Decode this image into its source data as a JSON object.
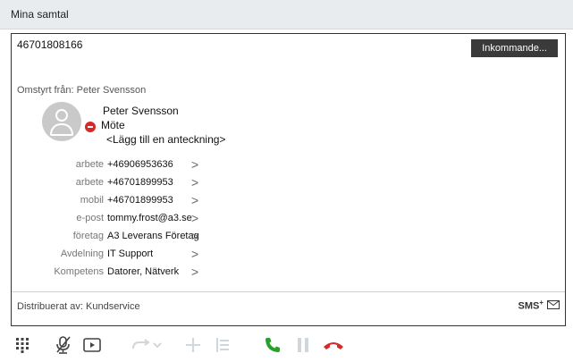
{
  "window": {
    "title": "Mina samtal"
  },
  "call": {
    "number": "46701808166",
    "incoming_button": "Inkommande...",
    "forwarded_from": "Omstyrt från: Peter Svensson"
  },
  "contact": {
    "name": "Peter Svensson",
    "status": "Möte",
    "note_placeholder": "<Lägg till en anteckning>",
    "status_color": "#d42a2a",
    "details": [
      {
        "label": "arbete",
        "value": "+46906953636"
      },
      {
        "label": "arbete",
        "value": "+46701899953"
      },
      {
        "label": "mobil",
        "value": "+46701899953"
      },
      {
        "label": "e-post",
        "value": "tommy.frost@a3.se"
      },
      {
        "label": "företag",
        "value": "A3 Leverans Företag"
      },
      {
        "label": "Avdelning",
        "value": "IT Support"
      },
      {
        "label": "Kompetens",
        "value": "Datorer, Nätverk"
      }
    ]
  },
  "distribution": {
    "text": "Distribuerat av: Kundservice",
    "sms_label": "SMS"
  },
  "toolbar": {
    "icons": [
      "dialpad-icon",
      "mute-icon",
      "screen-share-icon",
      "transfer-icon",
      "add-call-icon",
      "conference-icon",
      "answer-icon",
      "hold-icon",
      "hangup-icon"
    ],
    "answer_color": "#2aa02a",
    "hangup_color": "#d42a2a",
    "disabled_color": "#cfd6dc"
  }
}
